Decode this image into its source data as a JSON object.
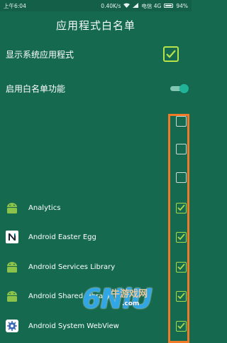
{
  "status_bar": {
    "time": "上午6:04",
    "net_speed": "0.40K/s",
    "carrier": "电信 4G",
    "battery": "94%"
  },
  "header": {
    "title": "应用程式白名单"
  },
  "settings": [
    {
      "label": "显示系统应用程式",
      "control": "checkbox",
      "checked": true
    },
    {
      "label": "启用白名单功能",
      "control": "toggle",
      "on": true
    }
  ],
  "unlabeled_rows": [
    {
      "checked": false
    },
    {
      "checked": false
    },
    {
      "checked": false
    }
  ],
  "apps": [
    {
      "name": "Analytics",
      "icon": "android-icon",
      "checked": true
    },
    {
      "name": "Android Easter Egg",
      "icon": "android-n-icon",
      "checked": true
    },
    {
      "name": "Android Services Library",
      "icon": "android-icon",
      "checked": true
    },
    {
      "name": "Android Shared Library",
      "icon": "android-icon",
      "checked": true
    },
    {
      "name": "Android System WebView",
      "icon": "gear-icon",
      "checked": true
    }
  ],
  "watermark": {
    "logo": "6NiU",
    "site": ".com",
    "tagline": "牛游戏网"
  },
  "colors": {
    "background": "#15694f",
    "check_accent": "#a9d64b",
    "highlight": "#f07a28",
    "android_green": "#8bc34a"
  }
}
